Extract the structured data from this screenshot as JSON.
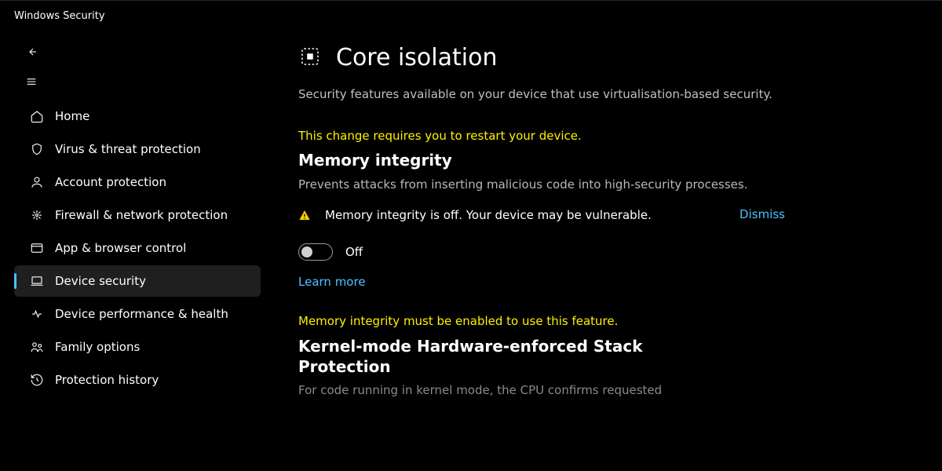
{
  "window": {
    "title": "Windows Security"
  },
  "sidebar": {
    "items": [
      {
        "label": "Home",
        "icon": "home-icon"
      },
      {
        "label": "Virus & threat protection",
        "icon": "shield-icon"
      },
      {
        "label": "Account protection",
        "icon": "account-icon"
      },
      {
        "label": "Firewall & network protection",
        "icon": "firewall-icon"
      },
      {
        "label": "App & browser control",
        "icon": "app-browser-icon"
      },
      {
        "label": "Device security",
        "icon": "device-icon",
        "active": true
      },
      {
        "label": "Device performance & health",
        "icon": "health-icon"
      },
      {
        "label": "Family options",
        "icon": "family-icon"
      },
      {
        "label": "Protection history",
        "icon": "history-icon"
      }
    ]
  },
  "page": {
    "title": "Core isolation",
    "subtitle": "Security features available on your device that use virtualisation-based security."
  },
  "memory_integrity": {
    "restart_alert": "This change requires you to restart your device.",
    "heading": "Memory integrity",
    "description": "Prevents attacks from inserting malicious code into high-security processes.",
    "warning_text": "Memory integrity is off. Your device may be vulnerable.",
    "dismiss_label": "Dismiss",
    "toggle_state_label": "Off",
    "learn_more_label": "Learn more"
  },
  "kernel_stack": {
    "prereq_alert": "Memory integrity must be enabled to use this feature.",
    "heading": "Kernel-mode Hardware-enforced Stack Protection",
    "description_truncated": "For code running in kernel mode, the CPU confirms requested"
  }
}
